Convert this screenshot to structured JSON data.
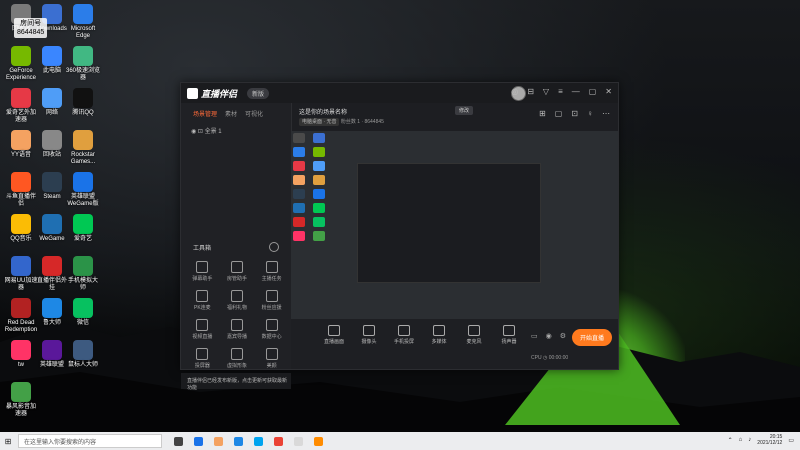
{
  "desktop": {
    "room_number_label": "房间号",
    "room_number_value": "8644845",
    "icons": [
      {
        "label": "回收站"
      },
      {
        "label": "Downloads"
      },
      {
        "label": "Microsoft Edge"
      },
      {
        "label": "GeForce Experience"
      },
      {
        "label": "此电脑"
      },
      {
        "label": "360极速浏览器"
      },
      {
        "label": "爱奇艺外加速器"
      },
      {
        "label": "网络"
      },
      {
        "label": "腾讯QQ"
      },
      {
        "label": "YY语音"
      },
      {
        "label": "回收站"
      },
      {
        "label": "Rockstar Games..."
      },
      {
        "label": "斗鱼直播伴侣"
      },
      {
        "label": "Steam"
      },
      {
        "label": "英雄联盟 WeGame版"
      },
      {
        "label": "QQ音乐"
      },
      {
        "label": "WeGame"
      },
      {
        "label": "爱奇艺"
      },
      {
        "label": "网易UU加速器"
      },
      {
        "label": "直播伴侣外挂"
      },
      {
        "label": "手机模拟大师"
      },
      {
        "label": "Red Dead Redemption"
      },
      {
        "label": "鲁大师"
      },
      {
        "label": "微信"
      },
      {
        "label": "tw"
      },
      {
        "label": "英雄联盟"
      },
      {
        "label": "鼠标人大师"
      },
      {
        "label": "暴风影音加速器"
      }
    ]
  },
  "app": {
    "logo": "直播伴侣",
    "version_pill": "新版",
    "title_icons": [
      "◎",
      "⊟",
      "▽",
      "≡",
      "—",
      "▢",
      "✕"
    ],
    "left_tabs": [
      "场景管理",
      "素材",
      "可视化"
    ],
    "scene_item": "全景 1",
    "tools_title": "工具箱",
    "tools": [
      {
        "label": "弹幕助手"
      },
      {
        "label": "房管助手"
      },
      {
        "label": "主播任务"
      },
      {
        "label": "PK连麦"
      },
      {
        "label": "福利礼物"
      },
      {
        "label": "粉丝应援"
      },
      {
        "label": "视频直播"
      },
      {
        "label": "嘉宾导播"
      },
      {
        "label": "数据中心"
      },
      {
        "label": "投屏器"
      },
      {
        "label": "虚拟形象"
      },
      {
        "label": "美颜"
      }
    ],
    "scene_title": "这是你的场景名称",
    "scene_button": "修改",
    "scene_sub_chip": "电脑桌面 · 无音",
    "scene_sub_meta": "粉丝数 1 · 8644845",
    "scene_right_icons": [
      "⊞",
      "▢",
      "⊡",
      "♀",
      "⋯"
    ],
    "bottom_items": [
      {
        "label": "直播画面"
      },
      {
        "label": "摄像头"
      },
      {
        "label": "手机投屏"
      },
      {
        "label": "多媒体"
      },
      {
        "label": "麦克风"
      },
      {
        "label": "扬声器"
      }
    ],
    "live_button": "开始直播",
    "bb_stats": "CPU  ◷ 00:00:00",
    "notice": "直播伴侣已经发布新版，点击更新可获取最新功能"
  },
  "taskbar": {
    "search_placeholder": "在这里输入你要搜索的内容",
    "clock_time": "20:15",
    "clock_date": "2021/12/12"
  }
}
